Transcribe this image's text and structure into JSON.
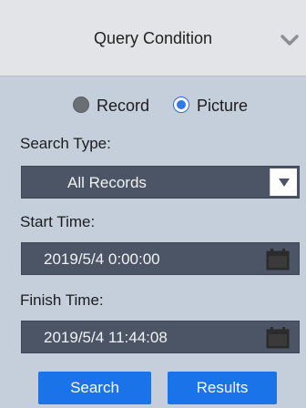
{
  "header": {
    "title": "Query Condition",
    "collapse_icon": "chevron-down-icon"
  },
  "mode": {
    "options": [
      {
        "label": "Record",
        "selected": false
      },
      {
        "label": "Picture",
        "selected": true
      }
    ]
  },
  "search_type": {
    "label": "Search Type:",
    "value": "All Records",
    "arrow_icon": "dropdown-arrow-icon"
  },
  "start_time": {
    "label": "Start Time:",
    "value": "2019/5/4 0:00:00",
    "icon": "calendar-icon"
  },
  "finish_time": {
    "label": "Finish Time:",
    "value": "2019/5/4 11:44:08",
    "icon": "calendar-icon"
  },
  "buttons": {
    "search": "Search",
    "results": "Results"
  },
  "colors": {
    "panel_bg": "#c5cfdb",
    "header_bg": "#e2e4e7",
    "field_bg": "#4b5566",
    "button_bg": "#1a73e8",
    "radio_selected": "#2f79e8"
  }
}
